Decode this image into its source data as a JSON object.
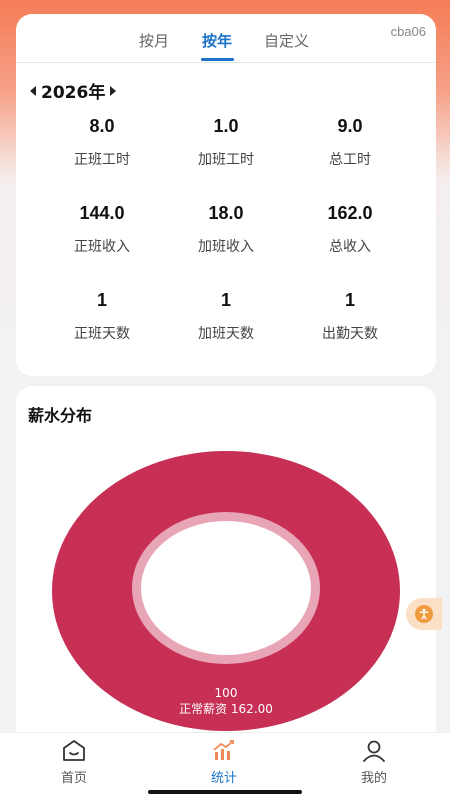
{
  "tabs": [
    {
      "label": "按月"
    },
    {
      "label": "按年"
    },
    {
      "label": "自定义"
    }
  ],
  "user": "cba06",
  "year": "2026年",
  "stats": [
    {
      "value": "8.0",
      "label": "正班工时"
    },
    {
      "value": "1.0",
      "label": "加班工时"
    },
    {
      "value": "9.0",
      "label": "总工时"
    },
    {
      "value": "144.0",
      "label": "正班收入"
    },
    {
      "value": "18.0",
      "label": "加班收入"
    },
    {
      "value": "162.0",
      "label": "总收入"
    },
    {
      "value": "1",
      "label": "正班天数"
    },
    {
      "value": "1",
      "label": "加班天数"
    },
    {
      "value": "1",
      "label": "出勤天数"
    }
  ],
  "chart_title": "薪水分布",
  "chart_data": {
    "type": "pie",
    "categories": [
      "正常薪资"
    ],
    "values": [
      162.0
    ],
    "percent": [
      "100"
    ],
    "color": "#c72f55"
  },
  "chart_labels": {
    "percent": "100",
    "main": "正常薪资 162.00"
  },
  "nav": [
    {
      "label": "首页",
      "icon": "home-icon"
    },
    {
      "label": "统计",
      "icon": "chart-icon"
    },
    {
      "label": "我的",
      "icon": "profile-icon"
    }
  ],
  "colors": {
    "accent": "#1a73c9",
    "donut": "#c72f55",
    "float_button": "#f19a3e"
  }
}
